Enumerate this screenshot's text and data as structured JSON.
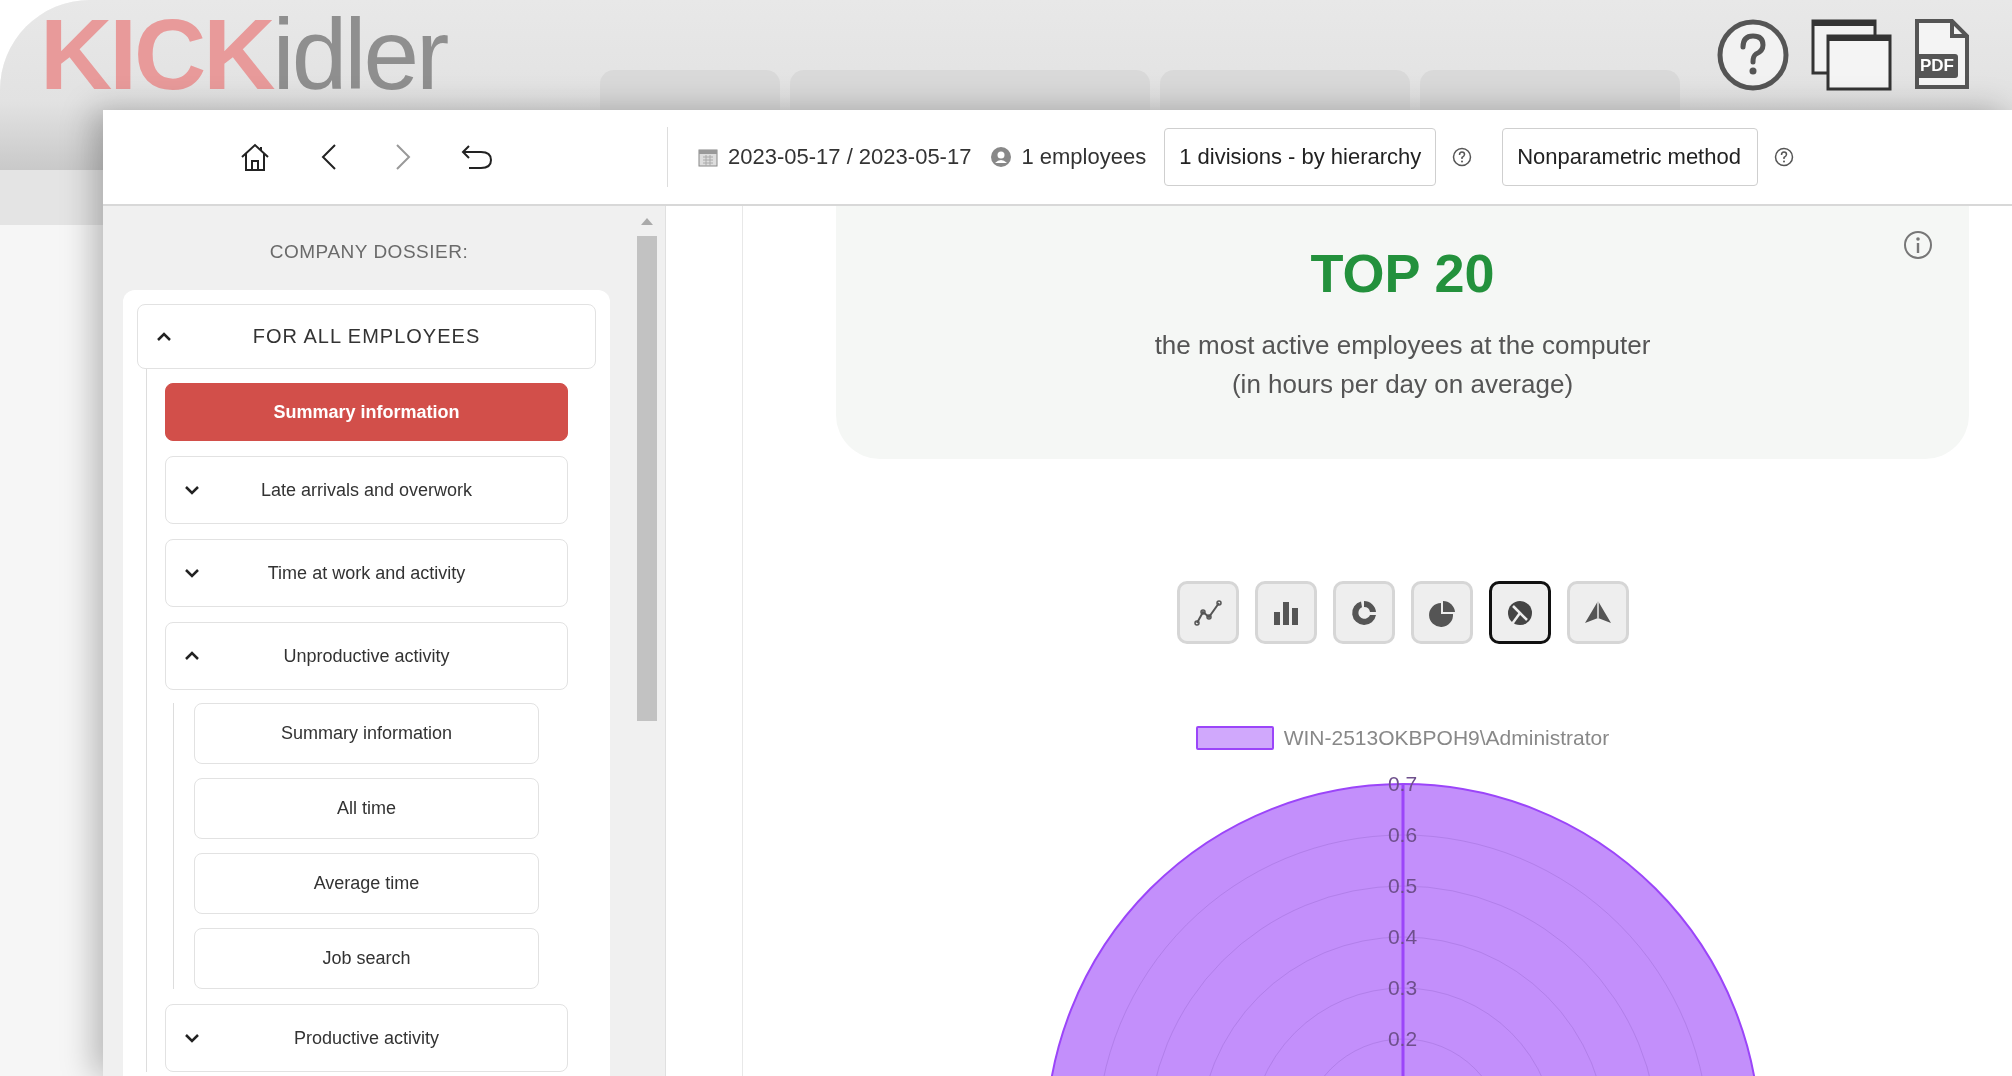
{
  "background_app": {
    "logo": {
      "first": "KICK",
      "second": "idler"
    },
    "pdf_label": "PDF"
  },
  "toolbar": {
    "nav_buttons": [
      {
        "kind": "home",
        "disabled": false
      },
      {
        "kind": "back",
        "disabled": false
      },
      {
        "kind": "forward",
        "disabled": true
      },
      {
        "kind": "undo",
        "disabled": false
      }
    ],
    "date_range": "2023-05-17 / 2023-05-17",
    "employees": "1 employees",
    "divisions_select": "1 divisions - by hierarchy",
    "method_select": "Nonparametric method"
  },
  "sidebar": {
    "heading": "COMPANY DOSSIER:",
    "section": {
      "label": "FOR ALL EMPLOYEES",
      "expanded": true,
      "items": [
        {
          "kind": "link",
          "label": "Summary information",
          "selected": true
        },
        {
          "kind": "group",
          "label": "Late arrivals and overwork",
          "expanded": false
        },
        {
          "kind": "group",
          "label": "Time at work and activity",
          "expanded": false
        },
        {
          "kind": "group",
          "label": "Unproductive activity",
          "expanded": true,
          "children": [
            {
              "kind": "link",
              "label": "Summary information",
              "selected": false
            },
            {
              "kind": "link",
              "label": "All time",
              "selected": false
            },
            {
              "kind": "link",
              "label": "Average time",
              "selected": false
            },
            {
              "kind": "link",
              "label": "Job search",
              "selected": false
            }
          ]
        },
        {
          "kind": "group",
          "label": "Productive activity",
          "expanded": false
        }
      ]
    }
  },
  "report": {
    "title": "TOP 20",
    "subtitle_lines": [
      "the most active employees at the computer",
      "(in hours per day on average)"
    ],
    "chart_types": [
      {
        "kind": "line",
        "selected": false
      },
      {
        "kind": "bar",
        "selected": false
      },
      {
        "kind": "donut",
        "selected": false
      },
      {
        "kind": "pie",
        "selected": false
      },
      {
        "kind": "polar",
        "selected": true
      },
      {
        "kind": "radar",
        "selected": false
      }
    ],
    "polar_chart": {
      "legend": [
        {
          "label": "WIN-2513OKBPOH9\\Administrator",
          "color": "#9b45f9"
        }
      ],
      "tick_labels": [
        "0.7",
        "0.6",
        "0.5",
        "0.4",
        "0.3",
        "0.2"
      ]
    }
  }
}
